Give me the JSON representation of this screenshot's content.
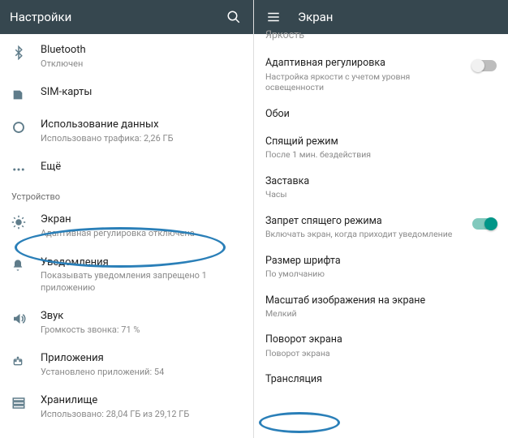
{
  "left": {
    "appbar": {
      "title": "Настройки"
    },
    "items": [
      {
        "label": "Bluetooth",
        "sub": "Отключен"
      },
      {
        "label": "SIM-карты",
        "sub": ""
      },
      {
        "label": "Использование данных",
        "sub": "Использовано трафика: 2,26 ГБ"
      },
      {
        "label": "Ещё",
        "sub": ""
      }
    ],
    "section": "Устройство",
    "items2": [
      {
        "label": "Экран",
        "sub": "Адаптивная регулировка отключена"
      },
      {
        "label": "Уведомления",
        "sub": "Показывать уведомления запрещено 1 приложению"
      },
      {
        "label": "Звук",
        "sub": "Громкость звонка: 71 %"
      },
      {
        "label": "Приложения",
        "sub": "Установлено приложений: 54"
      },
      {
        "label": "Хранилище",
        "sub": "Использовано: 28,04 ГБ из 29,12 ГБ"
      }
    ]
  },
  "right": {
    "appbar": {
      "title": "Экран"
    },
    "partial": {
      "label": "Яркость"
    },
    "items": [
      {
        "label": "Адаптивная регулировка",
        "sub": "Настройка яркости с учетом уровня освещенности",
        "switch": "off"
      },
      {
        "label": "Обои",
        "sub": ""
      },
      {
        "label": "Спящий режим",
        "sub": "После 1 мин. бездействия"
      },
      {
        "label": "Заставка",
        "sub": "Часы"
      },
      {
        "label": "Запрет спящего режима",
        "sub": "Включать экран, когда приходит уведомление",
        "switch": "on"
      },
      {
        "label": "Размер шрифта",
        "sub": "По умолчанию"
      },
      {
        "label": "Масштаб изображения на экране",
        "sub": "Мелкий"
      },
      {
        "label": "Поворот экрана",
        "sub": "Поворот экрана"
      },
      {
        "label": "Трансляция",
        "sub": ""
      }
    ]
  }
}
